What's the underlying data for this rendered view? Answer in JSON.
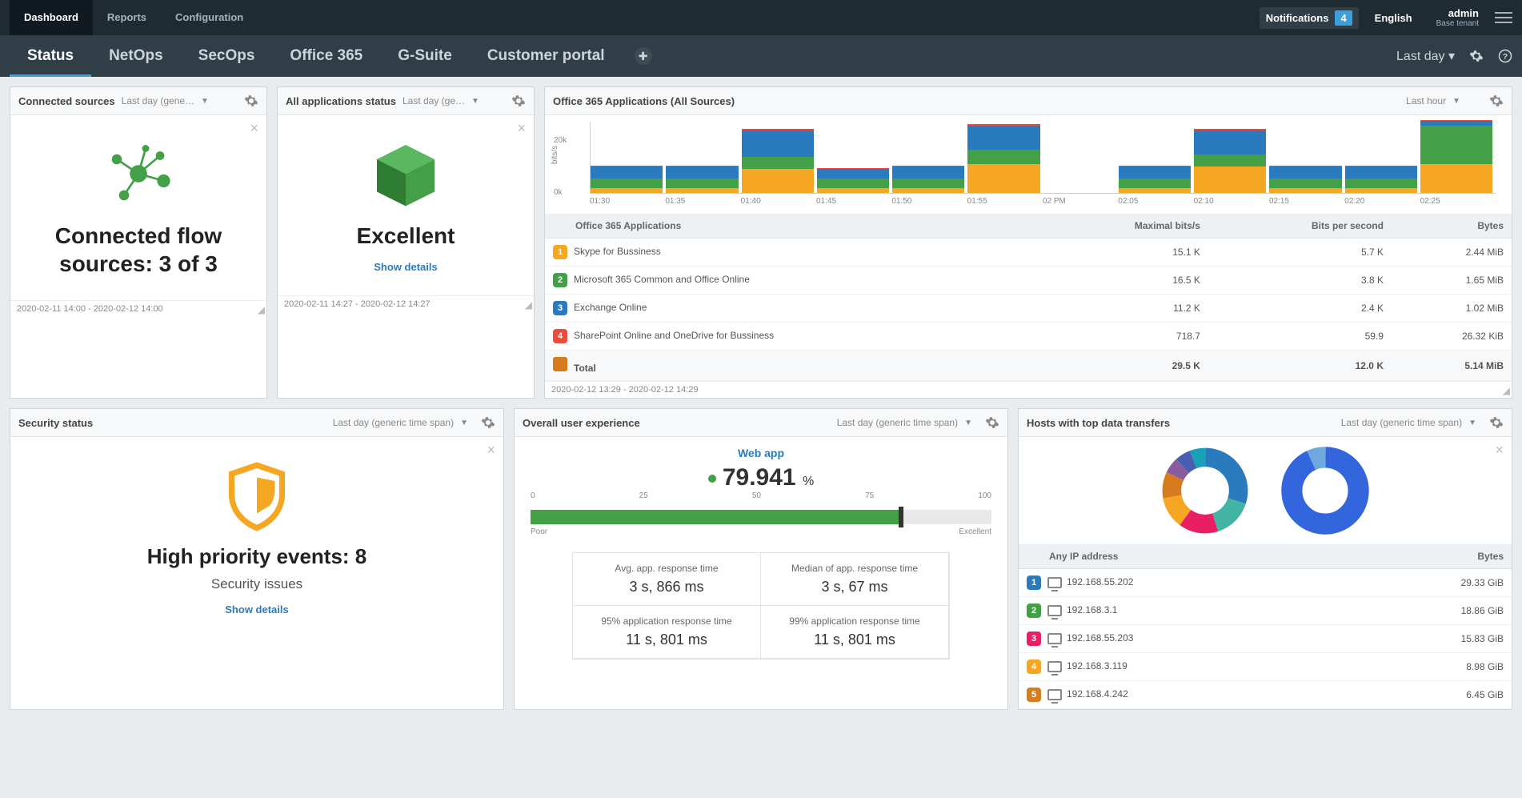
{
  "topbar": {
    "tabs": [
      "Dashboard",
      "Reports",
      "Configuration"
    ],
    "active": 0,
    "notifications_label": "Notifications",
    "notifications_count": "4",
    "language": "English",
    "user_name": "admin",
    "user_tenant": "Base tenant"
  },
  "subbar": {
    "tabs": [
      "Status",
      "NetOps",
      "SecOps",
      "Office 365",
      "G-Suite",
      "Customer portal"
    ],
    "active": 0,
    "time_selector": "Last day"
  },
  "panels": {
    "connected": {
      "title": "Connected sources",
      "sub": "Last day (gene…",
      "headline": "Connected flow sources: 3 of 3",
      "footer": "2020-02-11 14:00 - 2020-02-12 14:00"
    },
    "appstatus": {
      "title": "All applications status",
      "sub": "Last day (ge…",
      "headline": "Excellent",
      "link": "Show details",
      "footer": "2020-02-11 14:27 - 2020-02-12 14:27"
    },
    "o365": {
      "title": "Office 365 Applications (All Sources)",
      "time": "Last hour",
      "table_header": [
        "Office 365 Applications",
        "Maximal bits/s",
        "Bits per second",
        "Bytes"
      ],
      "rows": [
        {
          "n": "1",
          "c": "#f5a623",
          "name": "Skype for Bussiness",
          "a": "15.1 K",
          "b": "5.7 K",
          "d": "2.44 MiB"
        },
        {
          "n": "2",
          "c": "#43a047",
          "name": "Microsoft 365 Common and Office Online",
          "a": "16.5 K",
          "b": "3.8 K",
          "d": "1.65 MiB"
        },
        {
          "n": "3",
          "c": "#2a7bbd",
          "name": "Exchange Online",
          "a": "11.2 K",
          "b": "2.4 K",
          "d": "1.02 MiB"
        },
        {
          "n": "4",
          "c": "#e74c3c",
          "name": "SharePoint Online and OneDrive for Bussiness",
          "a": "718.7",
          "b": "59.9",
          "d": "26.32 KiB"
        }
      ],
      "total": {
        "c": "#d67b1e",
        "name": "Total",
        "a": "29.5 K",
        "b": "12.0 K",
        "d": "5.14 MiB"
      },
      "footer": "2020-02-12 13:29 - 2020-02-12 14:29"
    },
    "security": {
      "title": "Security status",
      "sub": "Last day (generic time span)",
      "headline": "High priority events: 8",
      "sub2": "Security issues",
      "link": "Show details"
    },
    "ux": {
      "title": "Overall user experience",
      "sub": "Last day (generic time span)",
      "webapp": "Web app",
      "pct": "79.941",
      "pct_unit": "%",
      "scale": [
        "0",
        "25",
        "50",
        "75",
        "100"
      ],
      "poor": "Poor",
      "excellent": "Excellent",
      "cells": [
        {
          "lbl": "Avg. app. response time",
          "val": "3 s, 866 ms"
        },
        {
          "lbl": "Median of app. response time",
          "val": "3 s, 67 ms"
        },
        {
          "lbl": "95% application response time",
          "val": "11 s, 801 ms"
        },
        {
          "lbl": "99% application response time",
          "val": "11 s, 801 ms"
        }
      ]
    },
    "hosts": {
      "title": "Hosts with top data transfers",
      "sub": "Last day (generic time span)",
      "header": [
        "Any IP address",
        "Bytes"
      ],
      "rows": [
        {
          "n": "1",
          "c": "#2a7bbd",
          "ip": "192.168.55.202",
          "b": "29.33 GiB"
        },
        {
          "n": "2",
          "c": "#43a047",
          "ip": "192.168.3.1",
          "b": "18.86 GiB"
        },
        {
          "n": "3",
          "c": "#e91e63",
          "ip": "192.168.55.203",
          "b": "15.83 GiB"
        },
        {
          "n": "4",
          "c": "#f5a623",
          "ip": "192.168.3.119",
          "b": "8.98 GiB"
        },
        {
          "n": "5",
          "c": "#d67b1e",
          "ip": "192.168.4.242",
          "b": "6.45 GiB"
        }
      ]
    }
  },
  "chart_data": {
    "type": "area",
    "title": "Office 365 Applications (All Sources)",
    "ylabel": "bits/s",
    "ylim": [
      0,
      30000
    ],
    "yticks": [
      "0k",
      "20k"
    ],
    "x": [
      "01:30",
      "01:35",
      "01:40",
      "01:45",
      "01:50",
      "01:55",
      "02 PM",
      "02:05",
      "02:10",
      "02:15",
      "02:20",
      "02:25"
    ],
    "series": [
      {
        "name": "Skype for Bussiness",
        "color": "#f5a623",
        "values": [
          2000,
          2000,
          10000,
          2000,
          2000,
          12000,
          0,
          2000,
          11000,
          2000,
          2000,
          12000
        ]
      },
      {
        "name": "Microsoft 365 Common and Office Online",
        "color": "#43a047",
        "values": [
          4000,
          4000,
          5000,
          4000,
          4000,
          6000,
          0,
          4000,
          5000,
          4000,
          4000,
          16000
        ]
      },
      {
        "name": "Exchange Online",
        "color": "#2a7bbd",
        "values": [
          5000,
          5000,
          11000,
          4000,
          5000,
          10000,
          0,
          5000,
          10000,
          5000,
          5000,
          2000
        ]
      },
      {
        "name": "SharePoint Online and OneDrive for Bussiness",
        "color": "#e74c3c",
        "values": [
          200,
          200,
          700,
          200,
          200,
          600,
          0,
          200,
          600,
          200,
          200,
          200
        ]
      }
    ]
  }
}
